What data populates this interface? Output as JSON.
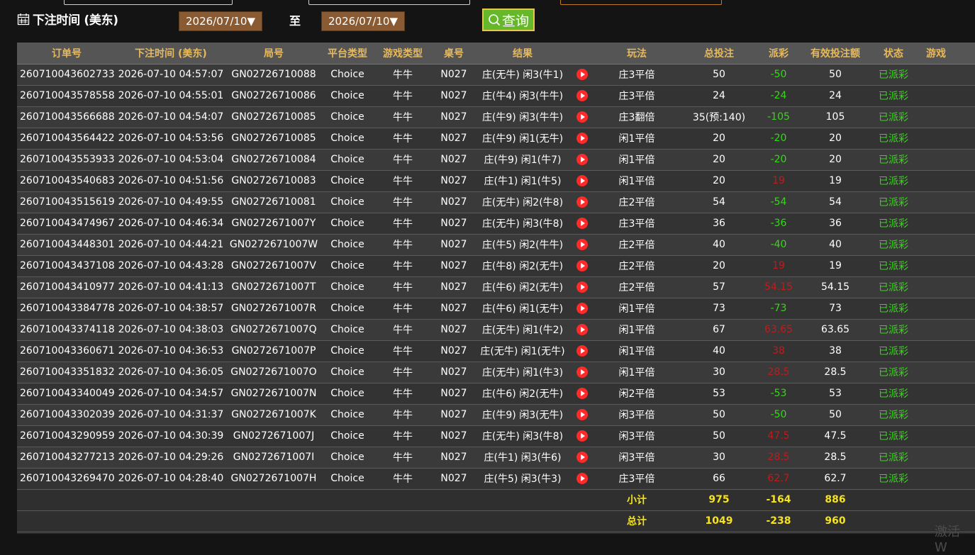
{
  "filter": {
    "label": "下注时间 (美东)",
    "start_date": "2026/07/10▼",
    "to_label": "至",
    "end_date": "2026/07/10▼",
    "query_label": "查询"
  },
  "table": {
    "columns": [
      "订单号",
      "下注时间 (美东)",
      "局号",
      "平台类型",
      "游戏类型",
      "桌号",
      "结果",
      "玩法",
      "总投注",
      "派彩",
      "有效投注额",
      "状态",
      "游戏"
    ],
    "rows": [
      {
        "order": "260710043602733",
        "time": "2026-07-10 04:57:07",
        "round": "GN02726710088",
        "platform": "Choice",
        "game": "牛牛",
        "table": "N027",
        "result": "庄(无牛) 闲3(牛1)",
        "play": "庄3平倍",
        "bet": "50",
        "payout": "-50",
        "payout_type": "neg",
        "valid": "50",
        "status": "已派彩"
      },
      {
        "order": "260710043578558",
        "time": "2026-07-10 04:55:01",
        "round": "GN02726710086",
        "platform": "Choice",
        "game": "牛牛",
        "table": "N027",
        "result": "庄(牛4) 闲3(牛牛)",
        "play": "庄3平倍",
        "bet": "24",
        "payout": "-24",
        "payout_type": "neg",
        "valid": "24",
        "status": "已派彩"
      },
      {
        "order": "260710043566688",
        "time": "2026-07-10 04:54:07",
        "round": "GN02726710085",
        "platform": "Choice",
        "game": "牛牛",
        "table": "N027",
        "result": "庄(牛9) 闲3(牛牛)",
        "play": "庄3翻倍",
        "bet": "35(预:140)",
        "payout": "-105",
        "payout_type": "neg",
        "valid": "105",
        "status": "已派彩"
      },
      {
        "order": "260710043564422",
        "time": "2026-07-10 04:53:56",
        "round": "GN02726710085",
        "platform": "Choice",
        "game": "牛牛",
        "table": "N027",
        "result": "庄(牛9) 闲1(无牛)",
        "play": "闲1平倍",
        "bet": "20",
        "payout": "-20",
        "payout_type": "neg",
        "valid": "20",
        "status": "已派彩"
      },
      {
        "order": "260710043553933",
        "time": "2026-07-10 04:53:04",
        "round": "GN02726710084",
        "platform": "Choice",
        "game": "牛牛",
        "table": "N027",
        "result": "庄(牛9) 闲1(牛7)",
        "play": "闲1平倍",
        "bet": "20",
        "payout": "-20",
        "payout_type": "neg",
        "valid": "20",
        "status": "已派彩"
      },
      {
        "order": "260710043540683",
        "time": "2026-07-10 04:51:56",
        "round": "GN02726710083",
        "platform": "Choice",
        "game": "牛牛",
        "table": "N027",
        "result": "庄(牛1) 闲1(牛5)",
        "play": "闲1平倍",
        "bet": "20",
        "payout": "19",
        "payout_type": "pos",
        "valid": "19",
        "status": "已派彩"
      },
      {
        "order": "260710043515619",
        "time": "2026-07-10 04:49:55",
        "round": "GN02726710081",
        "platform": "Choice",
        "game": "牛牛",
        "table": "N027",
        "result": "庄(无牛) 闲2(牛8)",
        "play": "庄2平倍",
        "bet": "54",
        "payout": "-54",
        "payout_type": "neg",
        "valid": "54",
        "status": "已派彩"
      },
      {
        "order": "260710043474967",
        "time": "2026-07-10 04:46:34",
        "round": "GN0272671007Y",
        "platform": "Choice",
        "game": "牛牛",
        "table": "N027",
        "result": "庄(无牛) 闲3(牛8)",
        "play": "庄3平倍",
        "bet": "36",
        "payout": "-36",
        "payout_type": "neg",
        "valid": "36",
        "status": "已派彩"
      },
      {
        "order": "260710043448301",
        "time": "2026-07-10 04:44:21",
        "round": "GN0272671007W",
        "platform": "Choice",
        "game": "牛牛",
        "table": "N027",
        "result": "庄(牛5) 闲2(牛牛)",
        "play": "庄2平倍",
        "bet": "40",
        "payout": "-40",
        "payout_type": "neg",
        "valid": "40",
        "status": "已派彩"
      },
      {
        "order": "260710043437108",
        "time": "2026-07-10 04:43:28",
        "round": "GN0272671007V",
        "platform": "Choice",
        "game": "牛牛",
        "table": "N027",
        "result": "庄(牛8) 闲2(无牛)",
        "play": "庄2平倍",
        "bet": "20",
        "payout": "19",
        "payout_type": "pos",
        "valid": "19",
        "status": "已派彩"
      },
      {
        "order": "260710043410977",
        "time": "2026-07-10 04:41:13",
        "round": "GN0272671007T",
        "platform": "Choice",
        "game": "牛牛",
        "table": "N027",
        "result": "庄(牛6) 闲2(无牛)",
        "play": "庄2平倍",
        "bet": "57",
        "payout": "54.15",
        "payout_type": "pos",
        "valid": "54.15",
        "status": "已派彩"
      },
      {
        "order": "260710043384778",
        "time": "2026-07-10 04:38:57",
        "round": "GN0272671007R",
        "platform": "Choice",
        "game": "牛牛",
        "table": "N027",
        "result": "庄(牛6) 闲1(无牛)",
        "play": "闲1平倍",
        "bet": "73",
        "payout": "-73",
        "payout_type": "neg",
        "valid": "73",
        "status": "已派彩"
      },
      {
        "order": "260710043374118",
        "time": "2026-07-10 04:38:03",
        "round": "GN0272671007Q",
        "platform": "Choice",
        "game": "牛牛",
        "table": "N027",
        "result": "庄(无牛) 闲1(牛2)",
        "play": "闲1平倍",
        "bet": "67",
        "payout": "63.65",
        "payout_type": "pos",
        "valid": "63.65",
        "status": "已派彩"
      },
      {
        "order": "260710043360671",
        "time": "2026-07-10 04:36:53",
        "round": "GN0272671007P",
        "platform": "Choice",
        "game": "牛牛",
        "table": "N027",
        "result": "庄(无牛) 闲1(无牛)",
        "play": "闲1平倍",
        "bet": "40",
        "payout": "38",
        "payout_type": "pos",
        "valid": "38",
        "status": "已派彩"
      },
      {
        "order": "260710043351832",
        "time": "2026-07-10 04:36:05",
        "round": "GN0272671007O",
        "platform": "Choice",
        "game": "牛牛",
        "table": "N027",
        "result": "庄(无牛) 闲1(牛3)",
        "play": "闲1平倍",
        "bet": "30",
        "payout": "28.5",
        "payout_type": "pos",
        "valid": "28.5",
        "status": "已派彩"
      },
      {
        "order": "260710043340049",
        "time": "2026-07-10 04:34:57",
        "round": "GN0272671007N",
        "platform": "Choice",
        "game": "牛牛",
        "table": "N027",
        "result": "庄(牛6) 闲2(无牛)",
        "play": "闲2平倍",
        "bet": "53",
        "payout": "-53",
        "payout_type": "neg",
        "valid": "53",
        "status": "已派彩"
      },
      {
        "order": "260710043302039",
        "time": "2026-07-10 04:31:37",
        "round": "GN0272671007K",
        "platform": "Choice",
        "game": "牛牛",
        "table": "N027",
        "result": "庄(牛9) 闲3(无牛)",
        "play": "闲3平倍",
        "bet": "50",
        "payout": "-50",
        "payout_type": "neg",
        "valid": "50",
        "status": "已派彩"
      },
      {
        "order": "260710043290959",
        "time": "2026-07-10 04:30:39",
        "round": "GN0272671007J",
        "platform": "Choice",
        "game": "牛牛",
        "table": "N027",
        "result": "庄(无牛) 闲3(牛8)",
        "play": "闲3平倍",
        "bet": "50",
        "payout": "47.5",
        "payout_type": "pos",
        "valid": "47.5",
        "status": "已派彩"
      },
      {
        "order": "260710043277213",
        "time": "2026-07-10 04:29:26",
        "round": "GN0272671007I",
        "platform": "Choice",
        "game": "牛牛",
        "table": "N027",
        "result": "庄(牛1) 闲3(牛6)",
        "play": "闲3平倍",
        "bet": "30",
        "payout": "28.5",
        "payout_type": "pos",
        "valid": "28.5",
        "status": "已派彩"
      },
      {
        "order": "260710043269470",
        "time": "2026-07-10 04:28:40",
        "round": "GN0272671007H",
        "platform": "Choice",
        "game": "牛牛",
        "table": "N027",
        "result": "庄(牛5) 闲3(牛3)",
        "play": "庄3平倍",
        "bet": "66",
        "payout": "62.7",
        "payout_type": "pos",
        "valid": "62.7",
        "status": "已派彩"
      }
    ],
    "subtotal": {
      "label": "小计",
      "bet": "975",
      "payout": "-164",
      "valid": "886"
    },
    "total": {
      "label": "总计",
      "bet": "1049",
      "payout": "-238",
      "valid": "960"
    }
  },
  "watermark": "激活 W"
}
